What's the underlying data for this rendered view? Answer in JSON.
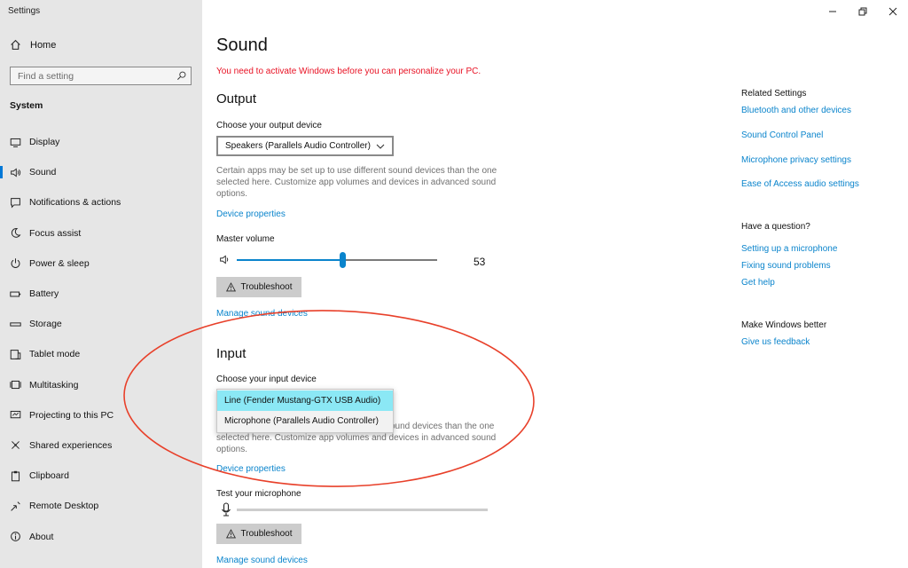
{
  "window": {
    "title": "Settings",
    "controls": [
      "minimize",
      "restore",
      "close"
    ]
  },
  "sidebar": {
    "home_label": "Home",
    "search_placeholder": "Find a setting",
    "section": "System",
    "items": [
      {
        "label": "Display",
        "icon": "display-icon"
      },
      {
        "label": "Sound",
        "icon": "speaker-icon",
        "active": true
      },
      {
        "label": "Notifications & actions",
        "icon": "notification-icon"
      },
      {
        "label": "Focus assist",
        "icon": "moon-icon"
      },
      {
        "label": "Power & sleep",
        "icon": "power-icon"
      },
      {
        "label": "Battery",
        "icon": "battery-icon"
      },
      {
        "label": "Storage",
        "icon": "storage-icon"
      },
      {
        "label": "Tablet mode",
        "icon": "tablet-icon"
      },
      {
        "label": "Multitasking",
        "icon": "multitasking-icon"
      },
      {
        "label": "Projecting to this PC",
        "icon": "project-icon"
      },
      {
        "label": "Shared experiences",
        "icon": "shared-icon"
      },
      {
        "label": "Clipboard",
        "icon": "clipboard-icon"
      },
      {
        "label": "Remote Desktop",
        "icon": "remote-icon"
      },
      {
        "label": "About",
        "icon": "info-icon"
      }
    ]
  },
  "main": {
    "title": "Sound",
    "activation_warning": "You need to activate Windows before you can personalize your PC.",
    "output": {
      "heading": "Output",
      "device_label": "Choose your output device",
      "device_value": "Speakers (Parallels Audio Controller)",
      "description": "Certain apps may be set up to use different sound devices than the one selected here. Customize app volumes and devices in advanced sound options.",
      "device_properties": "Device properties",
      "volume_label": "Master volume",
      "volume_value": "53",
      "volume_fraction": 0.53,
      "troubleshoot": "Troubleshoot",
      "manage_devices": "Manage sound devices"
    },
    "input": {
      "heading": "Input",
      "device_label": "Choose your input device",
      "options": [
        {
          "label": "Line (Fender Mustang-GTX USB Audio)",
          "selected": true
        },
        {
          "label": "Microphone (Parallels Audio Controller)",
          "selected": false
        }
      ],
      "description_line1_visible": "ound devices than the one",
      "description_rest": "selected here. Customize app volumes and devices in advanced sound options.",
      "device_properties": "Device properties",
      "test_label": "Test your microphone",
      "mic_level": 0,
      "troubleshoot": "Troubleshoot",
      "manage_devices": "Manage sound devices"
    }
  },
  "related": {
    "heading": "Related Settings",
    "links": [
      "Bluetooth and other devices",
      "Sound Control Panel",
      "Microphone privacy settings",
      "Ease of Access audio settings"
    ],
    "question_heading": "Have a question?",
    "question_links": [
      "Setting up a microphone",
      "Fixing sound problems",
      "Get help"
    ],
    "better_heading": "Make Windows better",
    "better_links": [
      "Give us feedback"
    ]
  },
  "colors": {
    "accent": "#0078d7",
    "link": "#0a84cc",
    "warning": "#e81123",
    "sidebar_bg": "#e6e6e6",
    "dropdown_selected": "#8be8f5",
    "annotation": "#e8402a"
  }
}
